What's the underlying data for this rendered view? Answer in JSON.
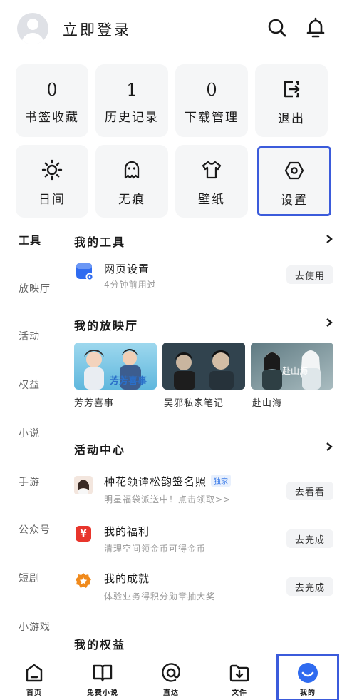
{
  "header": {
    "login_text": "立即登录",
    "search_icon": "search-icon",
    "bell_icon": "bell-icon"
  },
  "tiles": [
    {
      "value": "0",
      "label": "书签收藏"
    },
    {
      "value": "1",
      "label": "历史记录"
    },
    {
      "value": "0",
      "label": "下载管理"
    },
    {
      "icon": "logout-icon",
      "label": "退出"
    },
    {
      "icon": "sun-icon",
      "label": "日间"
    },
    {
      "icon": "ghost-icon",
      "label": "无痕"
    },
    {
      "icon": "shirt-icon",
      "label": "壁纸"
    },
    {
      "icon": "settings-hex-icon",
      "label": "设置"
    }
  ],
  "sidebar": {
    "items": [
      "工具",
      "放映厅",
      "活动",
      "权益",
      "小说",
      "手游",
      "公众号",
      "短剧",
      "小游戏"
    ]
  },
  "tools": {
    "title": "我的工具",
    "item_title": "网页设置",
    "item_sub": "4分钟前用过",
    "item_button": "去使用"
  },
  "theater": {
    "title": "我的放映厅",
    "items": [
      {
        "caption": "芳芳喜事",
        "poster_text": "芳芳喜事"
      },
      {
        "caption": "吴邪私家笔记",
        "poster_text": ""
      },
      {
        "caption": "赴山海",
        "poster_text": "赴山海"
      }
    ]
  },
  "activity": {
    "title": "活动中心",
    "items": [
      {
        "title": "种花领谭松韵签名照",
        "badge": "独家",
        "sub": "明星福袋派送中！点击领取>>",
        "button": "去看看"
      },
      {
        "title": "我的福利",
        "sub": "清理空间领金币可得金币",
        "button": "去完成"
      },
      {
        "title": "我的成就",
        "sub": "体验业务得积分勋章抽大奖",
        "button": "去完成"
      }
    ]
  },
  "rights": {
    "title": "我的权益"
  },
  "nav": {
    "items": [
      {
        "label": "首页",
        "icon": "home-icon"
      },
      {
        "label": "免费小说",
        "icon": "book-icon"
      },
      {
        "label": "直达",
        "icon": "at-icon"
      },
      {
        "label": "文件",
        "icon": "download-folder-icon"
      },
      {
        "label": "我的",
        "icon": "smile-icon"
      }
    ]
  },
  "colors": {
    "accent": "#2f6bf0",
    "highlight_border": "#3b5bdb",
    "tile_bg": "#f5f6f7"
  }
}
